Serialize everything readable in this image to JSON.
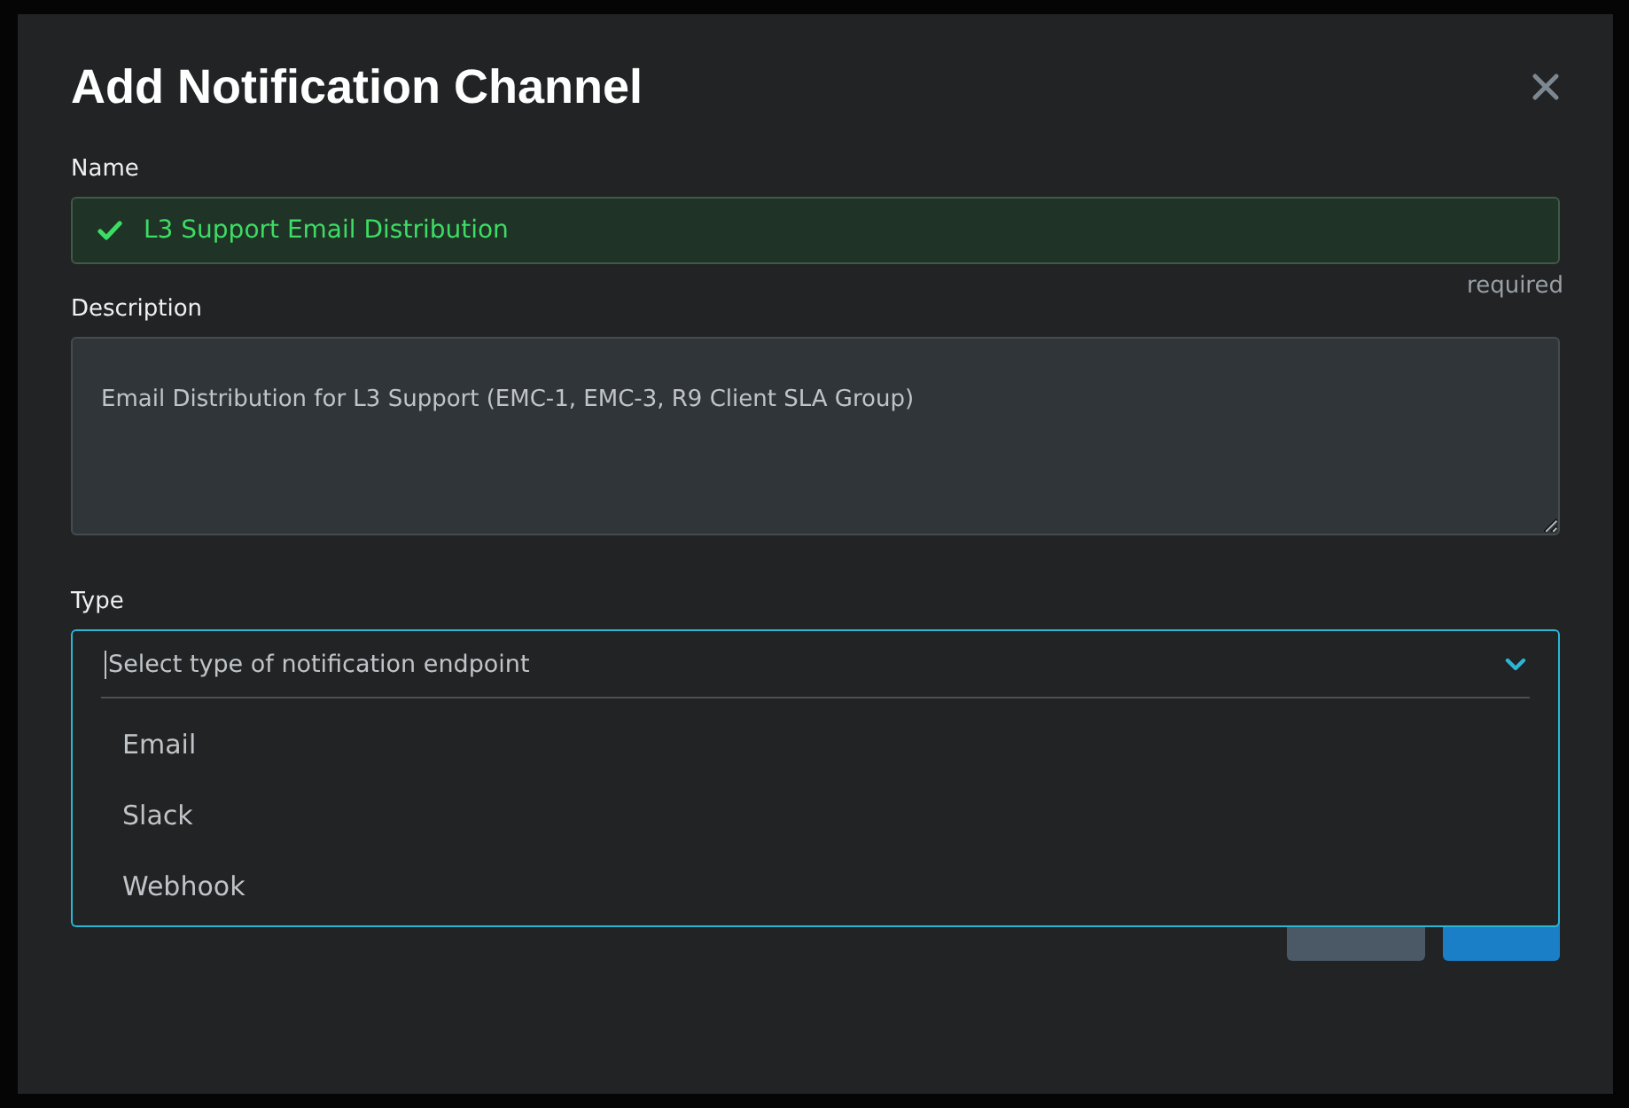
{
  "dialog": {
    "title": "Add Notification Channel"
  },
  "name_field": {
    "label": "Name",
    "value": "L3 Support Email Distribution",
    "valid": true,
    "hint": "required"
  },
  "description_field": {
    "label": "Description",
    "value": "Email Distribution for L3 Support (EMC-1, EMC-3, R9 Client SLA Group)"
  },
  "type_field": {
    "label": "Type",
    "placeholder": "Select type of notification endpoint",
    "expanded": true,
    "options": [
      {
        "label": "Email",
        "selected": false
      },
      {
        "label": "Slack",
        "selected": false
      },
      {
        "label": "Webhook",
        "selected": false
      }
    ]
  },
  "buttons": [
    {
      "kind": "secondary"
    },
    {
      "kind": "primary"
    }
  ]
}
